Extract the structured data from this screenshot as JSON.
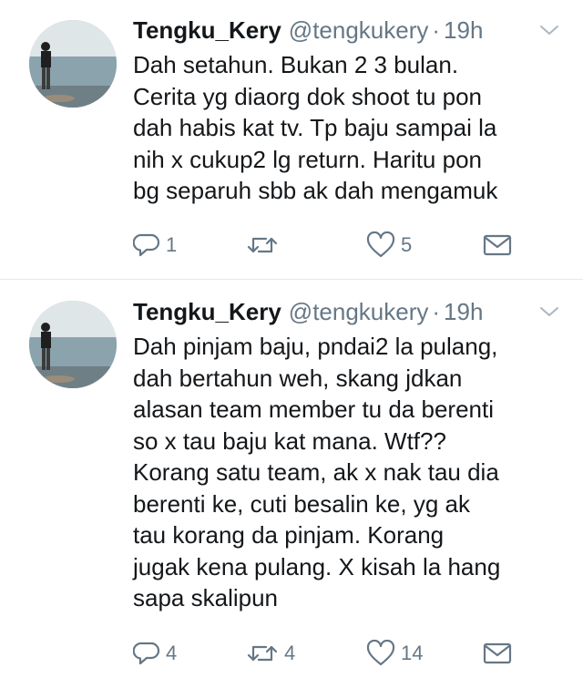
{
  "tweets": [
    {
      "display_name": "Tengku_Kery",
      "handle": "@tengkukery",
      "separator": "·",
      "time": "19h",
      "text": "Dah setahun. Bukan 2 3 bulan.\nCerita yg diaorg dok shoot tu pon\ndah habis kat tv. Tp baju sampai la\nnih x cukup2 lg return. Haritu pon\nbg separuh sbb ak dah mengamuk",
      "reply_count": "1",
      "retweet_count": "",
      "like_count": "5"
    },
    {
      "display_name": "Tengku_Kery",
      "handle": "@tengkukery",
      "separator": "·",
      "time": "19h",
      "text": "Dah pinjam baju, pndai2 la pulang,\ndah bertahun weh, skang jdkan\nalasan team member tu da berenti\nso x tau baju kat mana. Wtf??\nKorang satu team, ak x nak tau dia\nberenti ke, cuti besalin ke, yg ak\ntau korang da pinjam. Korang\njugak kena pulang. X kisah la hang\nsapa skalipun",
      "reply_count": "4",
      "retweet_count": "4",
      "like_count": "14"
    }
  ],
  "icons": {
    "reply": "reply-icon",
    "retweet": "retweet-icon",
    "like": "heart-icon",
    "dm": "envelope-icon",
    "caret": "chevron-down-icon"
  },
  "colors": {
    "name": "#14171a",
    "secondary": "#657786",
    "icon": "#657786",
    "divider": "#e1e8ed"
  }
}
